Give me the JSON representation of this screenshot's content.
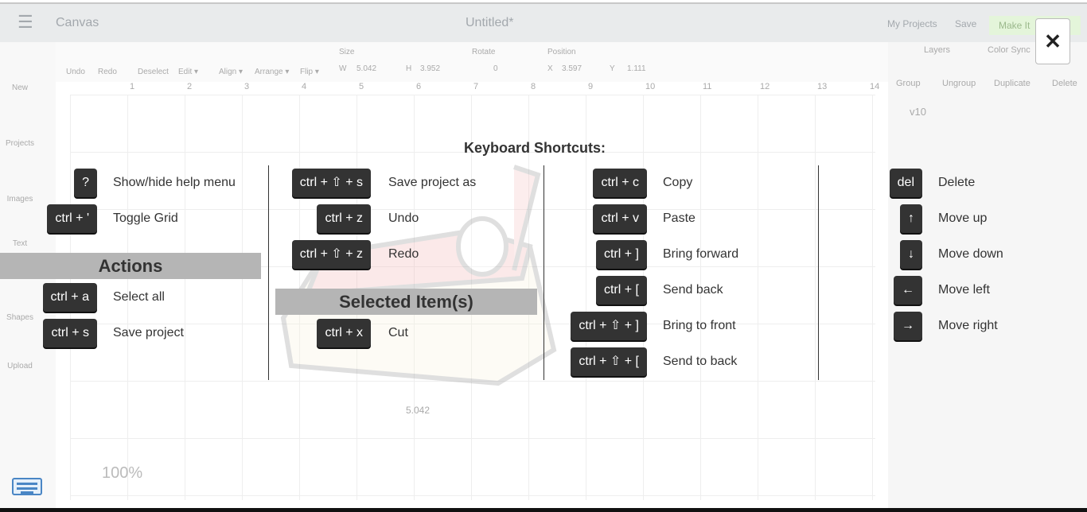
{
  "app": {
    "menu_icon": "hamburger-icon",
    "name": "Canvas",
    "doc_title": "Untitled*",
    "my_projects": "My Projects",
    "save": "Save",
    "make_it": "Make It"
  },
  "sidebar": [
    "New",
    "Projects",
    "Images",
    "Text",
    "Shapes",
    "Upload"
  ],
  "toolbar": {
    "undo": "Undo",
    "redo": "Redo",
    "deselect": "Deselect",
    "edit": "Edit ▾",
    "align": "Align ▾",
    "arrange": "Arrange ▾",
    "flip": "Flip ▾",
    "size": "Size",
    "w_label": "W",
    "w": "5.042",
    "h_label": "H",
    "h": "3.952",
    "rotate": "Rotate",
    "rotate_val": "0",
    "position": "Position",
    "x_label": "X",
    "x": "3.597",
    "y_label": "Y",
    "y": "1.111"
  },
  "ruler": [
    "1",
    "2",
    "3",
    "4",
    "5",
    "6",
    "7",
    "8",
    "9",
    "10",
    "11",
    "12",
    "13",
    "14"
  ],
  "canvas": {
    "width_readout": "5.042",
    "zoom": "100%"
  },
  "layers": {
    "tab_layers": "Layers",
    "tab_color_sync": "Color Sync",
    "group": "Group",
    "ungroup": "Ungroup",
    "duplicate": "Duplicate",
    "delete": "Delete",
    "layer_name": "v10"
  },
  "shortcuts": {
    "title": "Keyboard Shortcuts:",
    "actions_header": "Actions",
    "selected_header": "Selected Item(s)",
    "items": [
      {
        "key": "?",
        "label": "Show/hide help menu"
      },
      {
        "key": "ctrl + '",
        "label": "Toggle Grid"
      },
      {
        "key": "ctrl + a",
        "label": "Select all"
      },
      {
        "key": "ctrl + s",
        "label": "Save project"
      },
      {
        "key": "ctrl + ⇧ + s",
        "label": "Save project as"
      },
      {
        "key": "ctrl + z",
        "label": "Undo"
      },
      {
        "key": "ctrl + ⇧ + z",
        "label": "Redo"
      },
      {
        "key": "ctrl + x",
        "label": "Cut"
      },
      {
        "key": "ctrl + c",
        "label": "Copy"
      },
      {
        "key": "ctrl + v",
        "label": "Paste"
      },
      {
        "key": "ctrl + ]",
        "label": "Bring forward"
      },
      {
        "key": "ctrl + [",
        "label": "Send back"
      },
      {
        "key": "ctrl + ⇧ + ]",
        "label": "Bring to front"
      },
      {
        "key": "ctrl + ⇧ + [",
        "label": "Send to back"
      },
      {
        "key": "del",
        "label": "Delete"
      },
      {
        "key": "↑",
        "label": "Move up"
      },
      {
        "key": "↓",
        "label": "Move down"
      },
      {
        "key": "←",
        "label": "Move left"
      },
      {
        "key": "→",
        "label": "Move right"
      }
    ],
    "close": "✕"
  }
}
